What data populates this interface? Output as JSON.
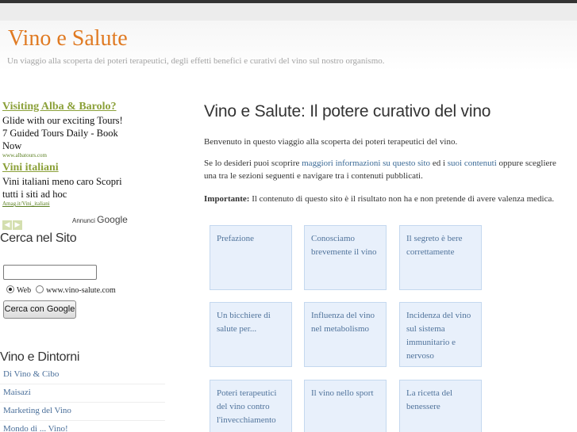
{
  "site": {
    "title": "Vino e Salute",
    "tagline": "Un viaggio alla scoperta dei poteri terapeutici, degli effetti benefici e curativi del vino sul nostro organismo."
  },
  "ads": [
    {
      "title": "Visiting Alba & Barolo?",
      "text": "Glide with our exciting Tours! 7 Guided Tours Daily - Book Now",
      "url": "www.albatours.com"
    },
    {
      "title": "Vini italiani",
      "text": "Vini italiani meno caro Scopri tutti i siti ad hoc",
      "url": "Amag.it/Vini_italiani"
    }
  ],
  "ads_by": {
    "prefix": "Annunci",
    "brand": "Google"
  },
  "search": {
    "heading": "Cerca nel Sito",
    "input_value": "",
    "option_web": "Web",
    "option_site": "www.vino-salute.com",
    "button": "Cerca con Google"
  },
  "dintorni": {
    "heading": "Vino e Dintorni",
    "links": [
      "Di Vino & Cibo",
      "Maisazi",
      "Marketing del Vino",
      "Mondo di ... Vino!"
    ]
  },
  "main": {
    "title": "Vino e Salute: Il potere curativo del vino",
    "intro": "Benvenuto in questo viaggio alla scoperta dei poteri terapeutici del vino.",
    "para2": {
      "t1": "Se lo desideri puoi scoprire ",
      "link1": "maggiori informazioni su questo sito",
      "t2": " ed i ",
      "link2": "suoi contenuti",
      "t3": " oppure scegliere una tra le sezioni seguenti e navigare tra i contenuti pubblicati."
    },
    "para3": {
      "label": "Importante:",
      "text": " Il contenuto di questo sito è il risultato non ha e non pretende di avere valenza medica."
    },
    "sections": [
      "Prefazione",
      "Conosciamo brevemente il vino",
      "Il segreto è bere correttamente",
      "Un bicchiere di salute per...",
      "Influenza del vino nel metabolismo",
      "Incidenza del vino sul sistema immunitario e nervoso",
      "Poteri terapeutici del vino contro l'invecchiamento",
      "Il vino nello sport",
      "La ricetta del benessere"
    ]
  },
  "colors": {
    "title": "#e07a22",
    "ad_title": "#8ca13a",
    "link": "#4a6f9a",
    "box_bg": "#e8f0fb"
  },
  "icons": {
    "ad_prev": "chevron-left-icon",
    "ad_next": "chevron-right-icon"
  }
}
